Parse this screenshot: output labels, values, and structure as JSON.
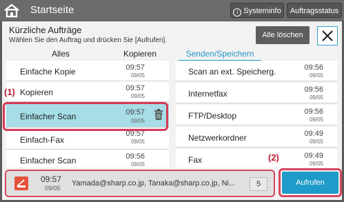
{
  "topbar": {
    "title": "Startseite",
    "systeminfo_label": "Systeminfo",
    "jobstatus_label": "Auftragsstatus"
  },
  "header": {
    "title": "Kürzliche Aufträge",
    "subtitle": "Wählen Sie den Auftrag und drücken Sie [Aufrufen].",
    "clear_label": "Alle löschen"
  },
  "tabs": [
    {
      "label": "Alles"
    },
    {
      "label": "Kopieren"
    },
    {
      "label": "Senden/Speichern",
      "active": true
    }
  ],
  "left_items": [
    {
      "name": "Einfache Kopie",
      "time": "09:57",
      "date": "09/05"
    },
    {
      "name": "Kopieren",
      "time": "09:57",
      "date": "09/05"
    },
    {
      "name": "Einfacher Scan",
      "time": "09:57",
      "date": "09/05",
      "selected": true
    },
    {
      "name": "Einfach-Fax",
      "time": "09:57",
      "date": "09/05"
    },
    {
      "name": "Einfacher Scan",
      "time": "09:56",
      "date": "09/05"
    }
  ],
  "right_items": [
    {
      "name": "Scan an ext. Speicherg.",
      "time": "09:56",
      "date": "09/05"
    },
    {
      "name": "Internetfax",
      "time": "09:56",
      "date": "09/05"
    },
    {
      "name": "FTP/Desktop",
      "time": "09:56",
      "date": "09/05"
    },
    {
      "name": "Netzwerkordner",
      "time": "09:49",
      "date": "09/05"
    },
    {
      "name": "Fax",
      "time": "09:49",
      "date": "09/05"
    }
  ],
  "annotations": {
    "one": "(1)",
    "two": "(2)"
  },
  "detail": {
    "time": "09:57",
    "date": "09/05",
    "addresses": "Yamada@sharp.co.jp, Tanaka@sharp.co.jp, Ni...",
    "count": "5"
  },
  "call_label": "Aufrufen",
  "colors": {
    "accent": "#1e9bc8",
    "selected_row": "#a6dde6",
    "annotation": "#c0182e"
  }
}
